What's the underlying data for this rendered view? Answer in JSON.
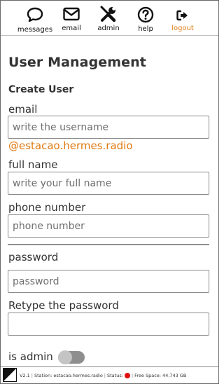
{
  "nav": {
    "items": [
      {
        "label": "messages",
        "icon": "chat-bubble-icon"
      },
      {
        "label": "email",
        "icon": "envelope-icon"
      },
      {
        "label": "admin",
        "icon": "tools-icon"
      },
      {
        "label": "help",
        "icon": "question-circle-icon"
      },
      {
        "label": "logout",
        "icon": "sign-out-icon"
      }
    ],
    "logout_color": "#e07a12"
  },
  "page": {
    "title": "User Management",
    "subtitle": "Create User"
  },
  "form": {
    "email_label": "email",
    "email_placeholder": "write the username",
    "email_domain": "@estacao.hermes.radio",
    "fullname_label": "full name",
    "fullname_placeholder": "write your full name",
    "phone_label": "phone number",
    "phone_placeholder": "phone number",
    "password_label": "password",
    "password_placeholder": "password",
    "retype_label": "Retype the password",
    "retype_placeholder": "",
    "admin_label": "is admin",
    "admin_enabled": false
  },
  "footer": {
    "version": "V2.1",
    "station": "Station: estacao.hermes.radio",
    "status": "Status:",
    "status_color": "#e01010",
    "free_space": "Free Space: 44,743 GB"
  }
}
